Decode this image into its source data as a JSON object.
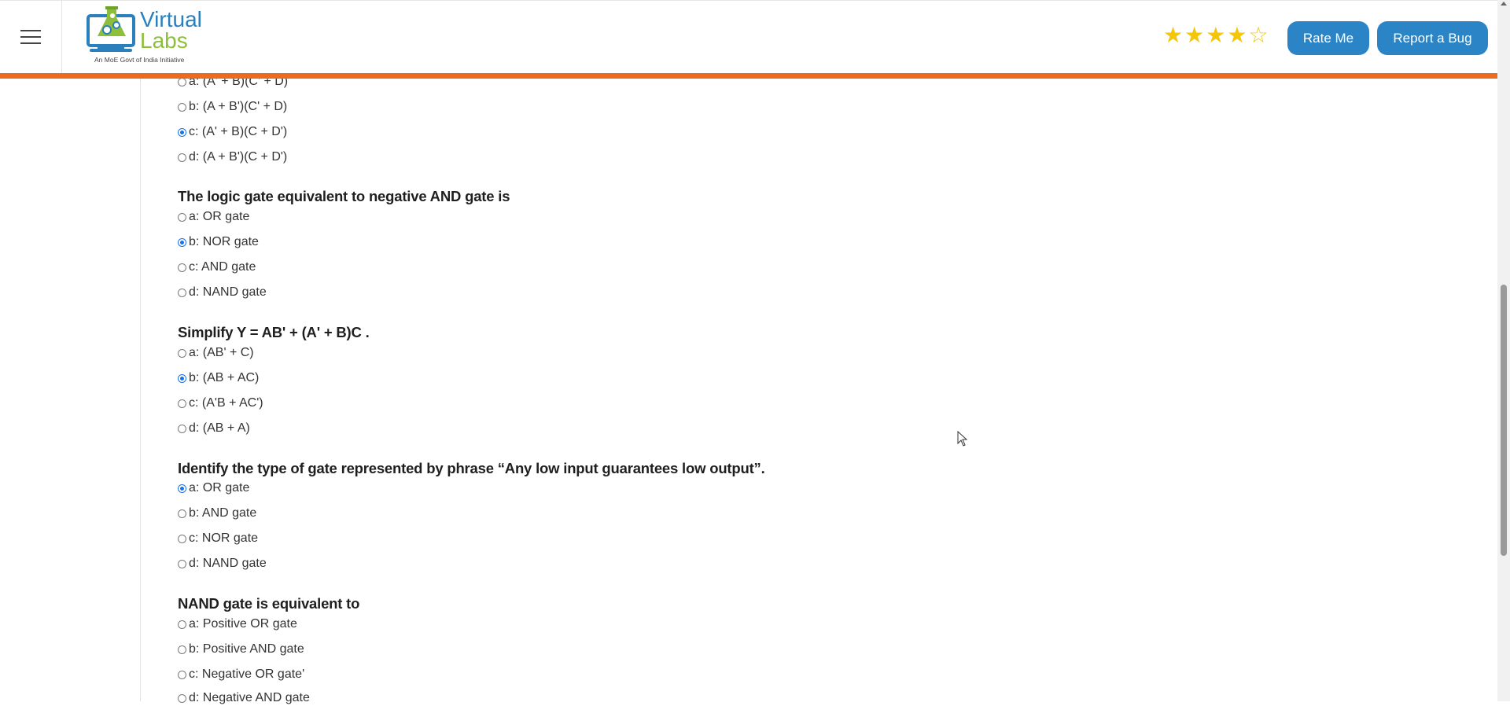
{
  "header": {
    "logo": {
      "title_line1": "Virtual",
      "title_line2": "Labs",
      "tagline": "An MoE Govt of India Initiative"
    },
    "rating": {
      "value": 4,
      "max": 5,
      "filled_color": "#f3c60a"
    },
    "rate_button": "Rate Me",
    "bug_button": "Report a Bug",
    "accent_color": "#ee6a1f",
    "button_color": "#2b84c6"
  },
  "quiz": {
    "partial_question": {
      "options": [
        {
          "label": "a: (A' + B)(C' + D)",
          "selected": false
        },
        {
          "label": "b: (A + B')(C' + D)",
          "selected": false
        },
        {
          "label": "c: (A' + B)(C + D')",
          "selected": true
        },
        {
          "label": "d: (A + B')(C + D')",
          "selected": false
        }
      ]
    },
    "questions": [
      {
        "text": "The logic gate equivalent to negative AND gate is",
        "options": [
          {
            "label": "a: OR gate",
            "selected": false
          },
          {
            "label": "b: NOR gate",
            "selected": true
          },
          {
            "label": "c: AND gate",
            "selected": false
          },
          {
            "label": "d: NAND gate",
            "selected": false
          }
        ]
      },
      {
        "text": "Simplify Y = AB' + (A' + B)C .",
        "options": [
          {
            "label": "a: (AB' + C)",
            "selected": false
          },
          {
            "label": "b: (AB + AC)",
            "selected": true
          },
          {
            "label": "c: (A'B + AC')",
            "selected": false
          },
          {
            "label": "d: (AB + A)",
            "selected": false
          }
        ]
      },
      {
        "text": "Identify the type of gate represented by phrase “Any low input guarantees low output”.",
        "options": [
          {
            "label": "a: OR gate",
            "selected": true
          },
          {
            "label": "b: AND gate",
            "selected": false
          },
          {
            "label": "c: NOR gate",
            "selected": false
          },
          {
            "label": "d: NAND gate",
            "selected": false
          }
        ]
      },
      {
        "text": "NAND gate is equivalent to",
        "options": [
          {
            "label": "a: Positive OR gate",
            "selected": false
          },
          {
            "label": "b: Positive AND gate",
            "selected": false
          },
          {
            "label": "c: Negative OR gate'",
            "selected": false
          },
          {
            "label": "d: Negative AND gate",
            "selected": false
          }
        ]
      }
    ]
  }
}
